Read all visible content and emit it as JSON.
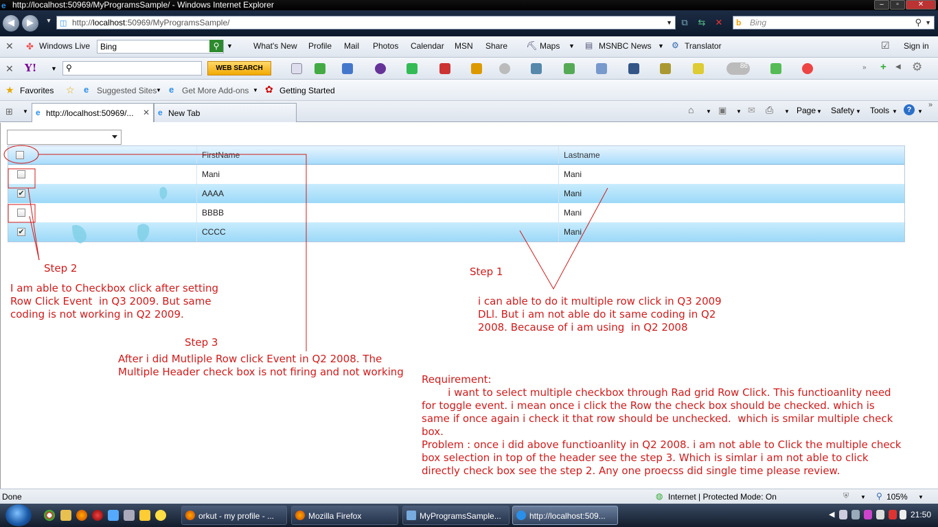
{
  "window": {
    "title": "http://localhost:50969/MyProgramsSample/ - Windows Internet Explorer"
  },
  "address_bar": {
    "url_prefix": "http://",
    "url_host": "localhost",
    "url_rest": ":50969/MyProgramsSample/",
    "search_placeholder": "Bing"
  },
  "live_toolbar": {
    "brand": "Windows Live",
    "search_value": "Bing",
    "links": [
      "What's New",
      "Profile",
      "Mail",
      "Photos",
      "Calendar",
      "MSN",
      "Share"
    ],
    "maps": "Maps",
    "msnbc": "MSNBC News",
    "translator": "Translator",
    "sign_in": "Sign in"
  },
  "yahoo_toolbar": {
    "logo": "Y!",
    "search_button": "WEB SEARCH",
    "weather_temp": "86"
  },
  "favorites_bar": {
    "favorites": "Favorites",
    "suggested_sites": "Suggested Sites",
    "get_addons": "Get More Add-ons",
    "getting_started": "Getting Started"
  },
  "tabs": [
    {
      "label": "http://localhost:50969/..."
    },
    {
      "label": "New Tab"
    }
  ],
  "command_bar": {
    "page": "Page",
    "safety": "Safety",
    "tools": "Tools",
    "help": "?"
  },
  "grid": {
    "headers": [
      "FirstName",
      "Lastname"
    ],
    "rows": [
      {
        "first": "Mani",
        "last": "Mani",
        "checked": false
      },
      {
        "first": "AAAA",
        "last": "Mani",
        "checked": true
      },
      {
        "first": "BBBB",
        "last": "Mani",
        "checked": false
      },
      {
        "first": "CCCC",
        "last": "Mani",
        "checked": true
      }
    ]
  },
  "annotations": {
    "step2_title": "Step 2",
    "step2_text": "I am able to Checkbox click after setting\nRow Click Event  in Q3 2009. But same\ncoding is not working in Q2 2009.",
    "step1_title": "Step 1",
    "step1_text": "i can able to do it multiple row click in Q3 2009\nDLl. But i am not able do it same coding in Q2\n2008. Because of i am using  in Q2 2008",
    "step3_title": "Step 3",
    "step3_text": "After i did Mutliple Row click Event in Q2 2008. The\nMultiple Header check box is not firing and not working",
    "requirement_text": "Requirement:\n        i want to select multiple checkbox through Rad grid Row Click. This functioanlity need\nfor toggle event. i mean once i click the Row the check box should be checked. which is\nsame if once again i check it that row should be unchecked.  which is smilar multiple check\nbox.\nProblem : once i did above functioanlity in Q2 2008. i am not able to Click the multiple check\nbox selection in top of the header see the step 3. Which is simlar i am not able to click\ndirectly check box see the step 2. Any one proecss did single time please review."
  },
  "status_bar": {
    "status": "Done",
    "zone": "Internet | Protected Mode: On",
    "zoom": "105%"
  },
  "taskbar": {
    "buttons": [
      {
        "label": "orkut - my profile - ..."
      },
      {
        "label": "Mozilla Firefox"
      },
      {
        "label": "MyProgramsSample..."
      },
      {
        "label": "http://localhost:509..."
      }
    ],
    "clock": "21:50"
  },
  "colors": {
    "annotation_red": "#d01b1b",
    "grid_header": "#a9dcfb",
    "grid_alt_row": "#9cd9f8"
  }
}
